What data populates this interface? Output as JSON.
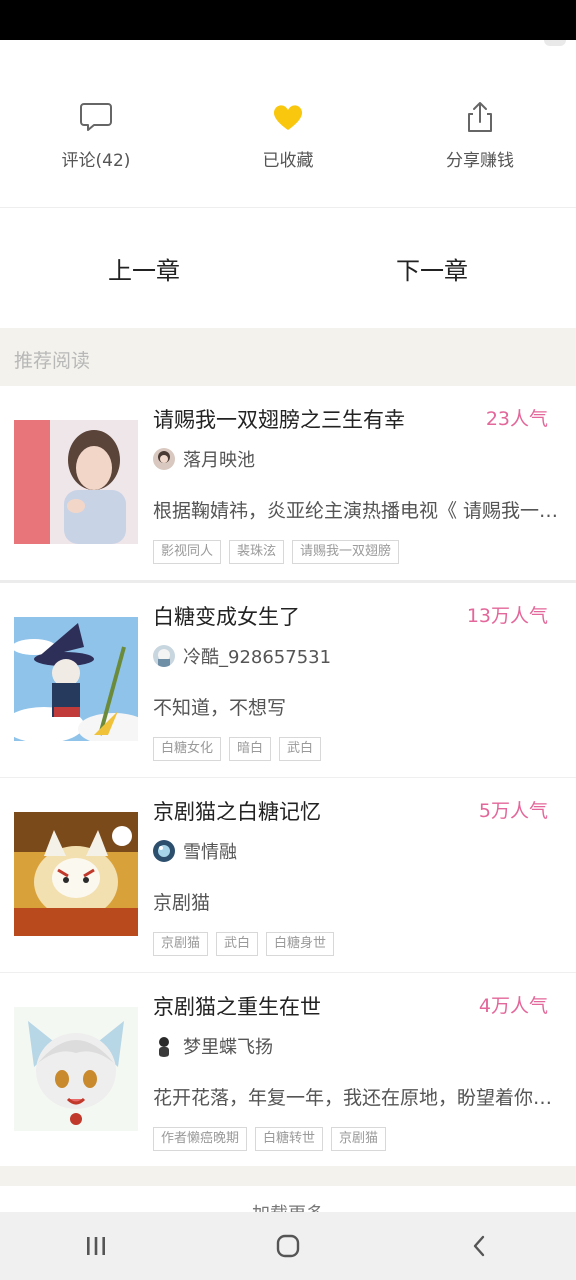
{
  "actions": {
    "comment_label": "评论(42)",
    "favorite_label": "已收藏",
    "share_label": "分享赚钱"
  },
  "chapter_nav": {
    "prev_label": "上一章",
    "next_label": "下一章"
  },
  "recommend": {
    "header": "推荐阅读",
    "items": [
      {
        "title": "请赐我一双翅膀之三生有幸",
        "popularity": "23人气",
        "author": "落月映池",
        "description": "根据鞠婧祎，炎亚纶主演热播电视《 请赐我一双翅膀",
        "tags": [
          "影视同人",
          "裴珠泫",
          "请赐我一双翅膀"
        ]
      },
      {
        "title": "白糖变成女生了",
        "popularity": "13万人气",
        "author": "冷酷_928657531",
        "description": "不知道，不想写",
        "tags": [
          "白糖女化",
          "暗白",
          "武白"
        ]
      },
      {
        "title": "京剧猫之白糖记忆",
        "popularity": "5万人气",
        "author": "雪情融",
        "description": "京剧猫",
        "tags": [
          "京剧猫",
          "武白",
          "白糖身世"
        ]
      },
      {
        "title": "京剧猫之重生在世",
        "popularity": "4万人气",
        "author": "梦里蝶飞扬",
        "description": "花开花落，年复一年，我还在原地，盼望着你的归来",
        "tags": [
          "作者懒癌晚期",
          "白糖转世",
          "京剧猫"
        ]
      }
    ]
  },
  "load_more": "加载更多",
  "colors": {
    "popularity": "#e3679a",
    "favorite_heart": "#f9c80e",
    "section_bg": "#f3f2ed"
  },
  "icons": {
    "comment": "speech-bubble-icon",
    "favorite": "heart-icon",
    "share": "share-upload-icon",
    "nav_recent": "recent-apps-icon",
    "nav_home": "home-icon",
    "nav_back": "back-icon"
  }
}
